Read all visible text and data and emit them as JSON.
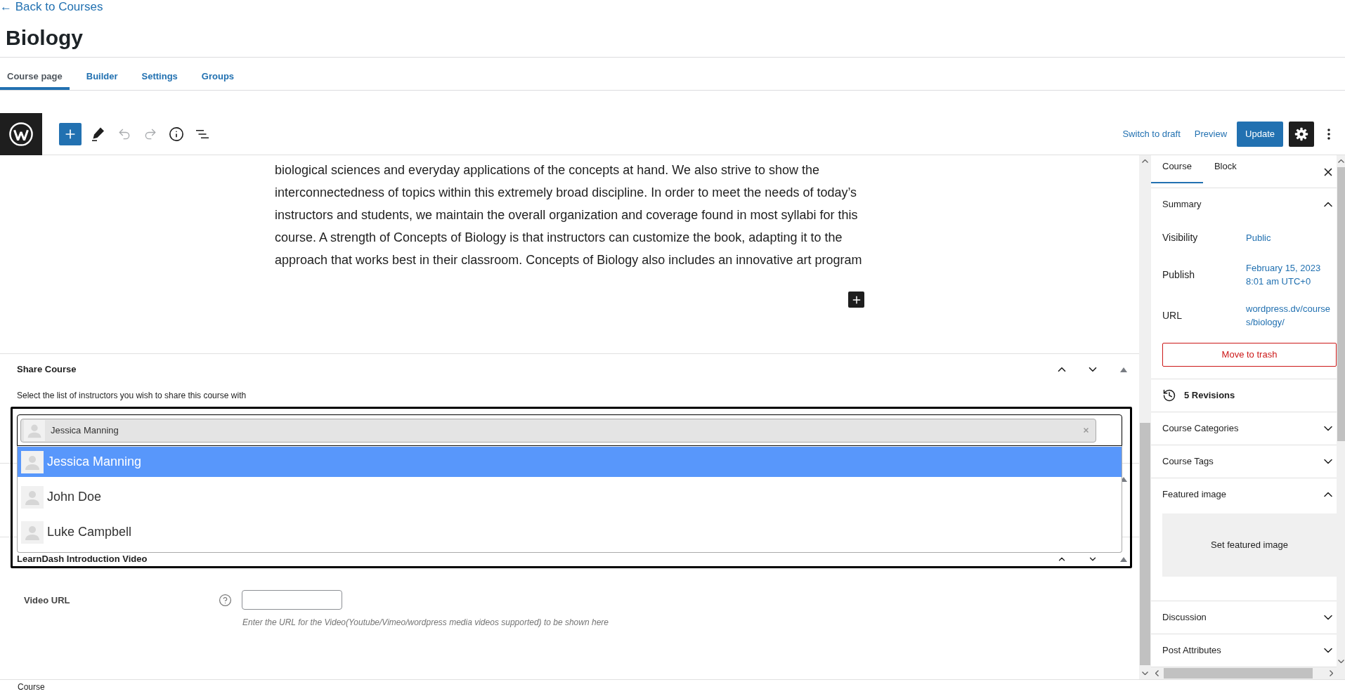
{
  "back_link": "← Back to Courses",
  "title": "Biology",
  "tabs": [
    {
      "label": "Course page",
      "selected": true
    },
    {
      "label": "Builder",
      "selected": false
    },
    {
      "label": "Settings",
      "selected": false
    },
    {
      "label": "Groups",
      "selected": false
    }
  ],
  "toolbar": {
    "tools": [
      {
        "kind": "inserter",
        "disabled": false
      },
      {
        "kind": "pencil",
        "disabled": false
      },
      {
        "kind": "undo",
        "disabled": true
      },
      {
        "kind": "redo",
        "disabled": true
      },
      {
        "kind": "info",
        "disabled": false
      },
      {
        "kind": "list",
        "disabled": false
      }
    ],
    "actions": [
      {
        "kind": "link",
        "label": "Switch to draft"
      },
      {
        "kind": "link",
        "label": "Preview"
      },
      {
        "kind": "primary",
        "label": "Update"
      }
    ],
    "settings_pressed": true
  },
  "editor": {
    "paragraph_lines": [
      "biological sciences and everyday applications of the concepts at hand. We also strive to show the",
      "interconnectedness of topics within this extremely broad discipline. In order to meet the needs of today’s",
      "instructors and students, we maintain the overall organization and coverage found in most syllabi for this",
      "course. A strength of Concepts of Biology is that instructors can customize the book, adapting it to the",
      "approach that works best in their classroom. Concepts of Biology also includes an innovative art program"
    ]
  },
  "share_course": {
    "title": "Share Course",
    "description": "Select the list of instructors you wish to share this course with",
    "selected_tags": [
      {
        "name": "Jessica Manning"
      }
    ],
    "options": [
      {
        "name": "Jessica Manning",
        "selected": true
      },
      {
        "name": "John Doe",
        "selected": false
      },
      {
        "name": "Luke Campbell",
        "selected": false
      }
    ]
  },
  "intro_video": {
    "title": "LearnDash Introduction Video",
    "field": {
      "label": "Video URL",
      "hint": "Enter the URL for the Video(Youtube/Vimeo/wordpress media videos supported) to be shown here"
    }
  },
  "sidebar": {
    "tabs": [
      {
        "label": "Course",
        "selected": true
      },
      {
        "label": "Block",
        "selected": false
      }
    ],
    "panels": [
      {
        "kind": "summary",
        "title": "Summary",
        "expanded": true,
        "rows": [
          {
            "kind": "text",
            "label": "Visibility",
            "value": "Public"
          },
          {
            "kind": "text",
            "label": "Publish",
            "value": "February 15, 2023 8:01 am UTC+0"
          },
          {
            "kind": "url",
            "label": "URL",
            "value": "wordpress.dv/courses/biology/"
          }
        ],
        "trash": "Move to trash"
      },
      {
        "kind": "revisions",
        "title": "5 Revisions"
      },
      {
        "kind": "panel",
        "title": "Course Categories",
        "expanded": false
      },
      {
        "kind": "panel",
        "title": "Course Tags",
        "expanded": false
      },
      {
        "kind": "featured_image",
        "title": "Featured image",
        "expanded": true,
        "button": "Set featured image"
      },
      {
        "kind": "panel",
        "title": "Discussion",
        "expanded": false
      },
      {
        "kind": "panel",
        "title": "Post Attributes",
        "expanded": false
      }
    ]
  },
  "breadcrumb": "Course"
}
